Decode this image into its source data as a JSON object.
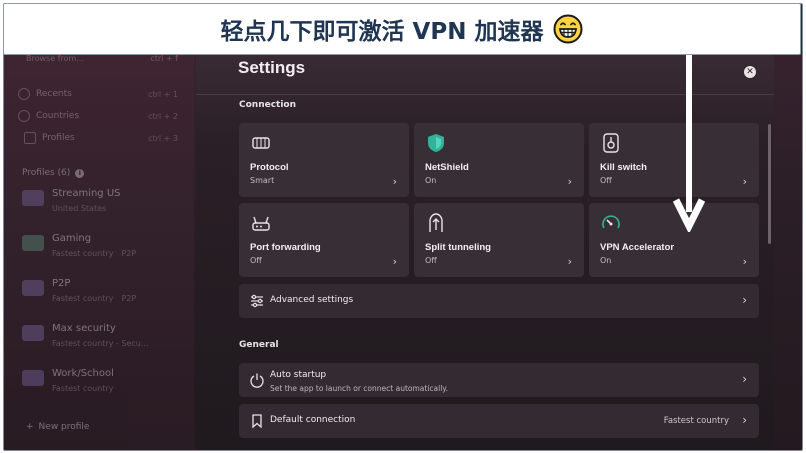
{
  "banner": {
    "text": "轻点几下即可激活 VPN 加速器",
    "emoji": "grinning-face-icon"
  },
  "sidebar": {
    "search_placeholder": "Browse from...",
    "search_shortcut": "ctrl + f",
    "nav": [
      {
        "label": "Recents",
        "shortcut": "ctrl + 1",
        "icon": "clock-icon"
      },
      {
        "label": "Countries",
        "shortcut": "ctrl + 2",
        "icon": "globe-icon"
      },
      {
        "label": "Profiles",
        "shortcut": "ctrl + 3",
        "icon": "profiles-icon"
      }
    ],
    "profiles_header": "Profiles (6)",
    "profiles": [
      {
        "name": "Streaming US",
        "sub": "United States",
        "p2p": ""
      },
      {
        "name": "Gaming",
        "sub": "Fastest country",
        "p2p": "P2P"
      },
      {
        "name": "P2P",
        "sub": "Fastest country",
        "p2p": "P2P"
      },
      {
        "name": "Max security",
        "sub": "Fastest country - Secu...",
        "p2p": ""
      },
      {
        "name": "Work/School",
        "sub": "Fastest country",
        "p2p": ""
      }
    ],
    "new_profile": "New profile"
  },
  "settings": {
    "title": "Settings",
    "connection_label": "Connection",
    "tiles": [
      {
        "name": "Protocol",
        "value": "Smart",
        "icon": "protocol-icon"
      },
      {
        "name": "NetShield",
        "value": "On",
        "icon": "shield-icon"
      },
      {
        "name": "Kill switch",
        "value": "Off",
        "icon": "kill-switch-icon"
      },
      {
        "name": "Port forwarding",
        "value": "Off",
        "icon": "router-icon"
      },
      {
        "name": "Split tunneling",
        "value": "Off",
        "icon": "split-tunnel-icon"
      },
      {
        "name": "VPN Accelerator",
        "value": "On",
        "icon": "speedometer-icon"
      }
    ],
    "advanced": "Advanced settings",
    "general_label": "General",
    "auto_startup": {
      "title": "Auto startup",
      "sub": "Set the app to launch or connect automatically."
    },
    "default_connection": {
      "title": "Default connection",
      "value": "Fastest country"
    }
  },
  "colors": {
    "banner_text": "#1f3552",
    "tile_bg": "#372f35",
    "panel_bg": "#1f1a1e",
    "shield_green": "#2fb39a"
  }
}
